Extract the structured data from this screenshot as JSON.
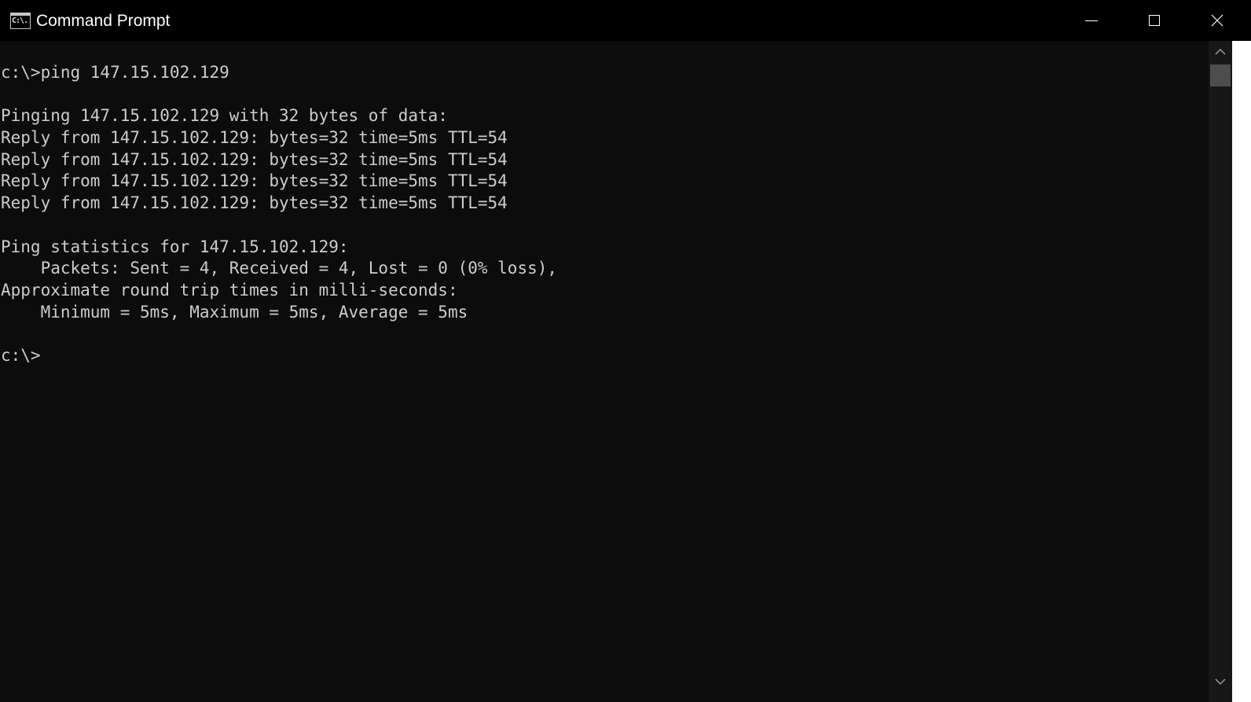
{
  "window": {
    "title": "Command Prompt",
    "icon": "cmd-icon",
    "icon_text": "C:\\.",
    "controls": {
      "minimize": "minimize-icon",
      "maximize": "maximize-icon",
      "close": "close-icon"
    }
  },
  "console": {
    "lines": [
      "c:\\>ping 147.15.102.129",
      "",
      "Pinging 147.15.102.129 with 32 bytes of data:",
      "Reply from 147.15.102.129: bytes=32 time=5ms TTL=54",
      "Reply from 147.15.102.129: bytes=32 time=5ms TTL=54",
      "Reply from 147.15.102.129: bytes=32 time=5ms TTL=54",
      "Reply from 147.15.102.129: bytes=32 time=5ms TTL=54",
      "",
      "Ping statistics for 147.15.102.129:",
      "    Packets: Sent = 4, Received = 4, Lost = 0 (0% loss),",
      "Approximate round trip times in milli-seconds:",
      "    Minimum = 5ms, Maximum = 5ms, Average = 5ms",
      "",
      "c:\\>"
    ]
  },
  "scrollbar": {
    "up": "chevron-up-icon",
    "down": "chevron-down-icon",
    "thumb_position": 0
  },
  "colors": {
    "background": "#0c0c0c",
    "text": "#cccccc",
    "titlebar": "#000000",
    "scroll_track": "#171717",
    "scroll_thumb": "#4d4d4d"
  }
}
